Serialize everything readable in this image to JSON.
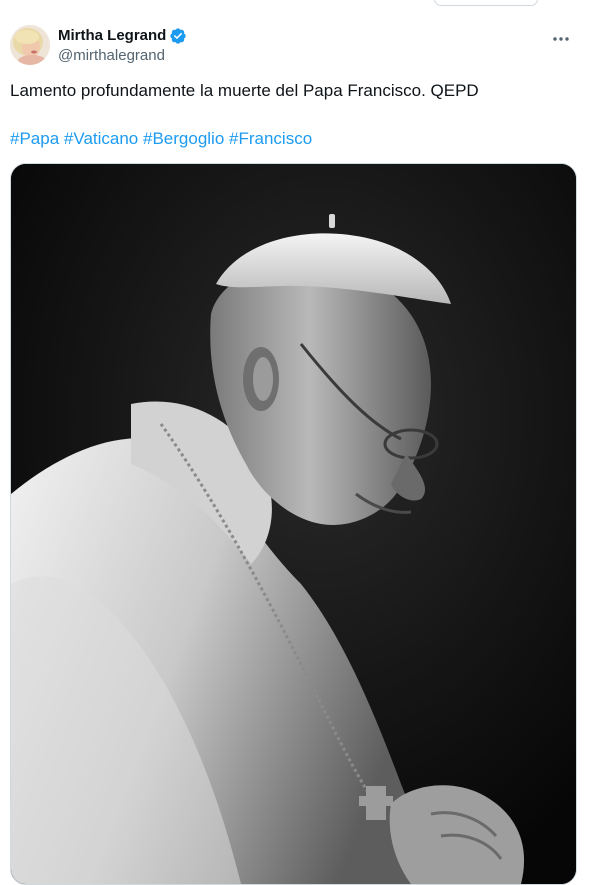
{
  "tweet": {
    "author": {
      "display_name": "Mirtha Legrand",
      "handle": "@mirthalegrand",
      "verified": true,
      "avatar_icon": "profile-photo"
    },
    "more_icon": "more-horizontal-icon",
    "text": "Lamento profundamente la muerte del Papa Francisco. QEPD",
    "hashtags": [
      "#Papa",
      "#Vaticano",
      "#Bergoglio",
      "#Francisco"
    ],
    "media": {
      "type": "photo",
      "style": "black-and-white portrait"
    }
  },
  "colors": {
    "link": "#1d9bf0",
    "verified_badge": "#1d9bf0",
    "secondary_text": "#536471",
    "border": "#cfd9de"
  }
}
